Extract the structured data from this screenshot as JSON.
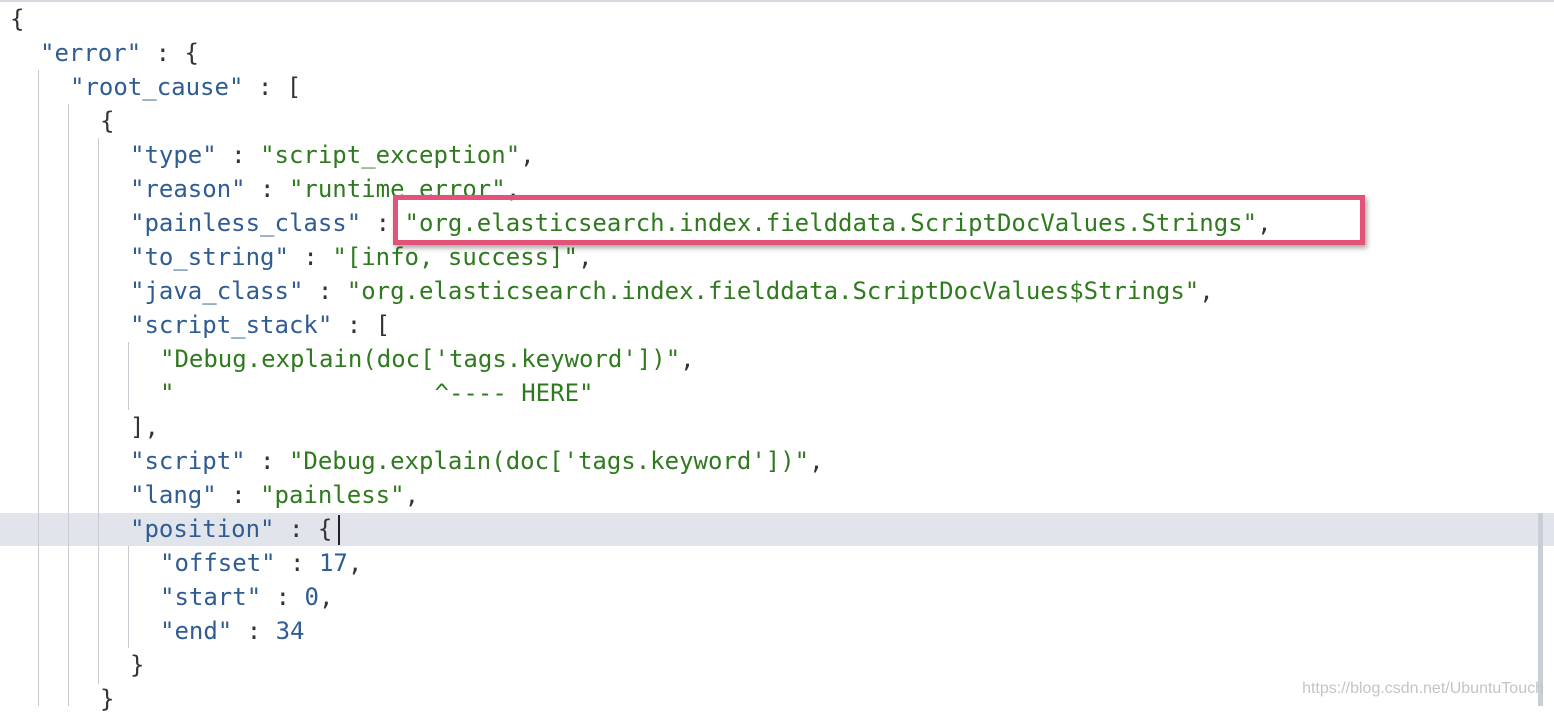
{
  "code_lines": [
    {
      "indent": 0,
      "parts": [
        {
          "t": "{",
          "c": "punc"
        }
      ]
    },
    {
      "indent": 1,
      "parts": [
        {
          "t": "\"error\"",
          "c": "key"
        },
        {
          "t": " : {",
          "c": "punc"
        }
      ]
    },
    {
      "indent": 2,
      "parts": [
        {
          "t": "\"root_cause\"",
          "c": "key"
        },
        {
          "t": " : [",
          "c": "punc"
        }
      ]
    },
    {
      "indent": 3,
      "parts": [
        {
          "t": "{",
          "c": "punc"
        }
      ]
    },
    {
      "indent": 4,
      "parts": [
        {
          "t": "\"type\"",
          "c": "key"
        },
        {
          "t": " : ",
          "c": "punc"
        },
        {
          "t": "\"script_exception\"",
          "c": "str"
        },
        {
          "t": ",",
          "c": "punc"
        }
      ]
    },
    {
      "indent": 4,
      "parts": [
        {
          "t": "\"reason\"",
          "c": "key"
        },
        {
          "t": " : ",
          "c": "punc"
        },
        {
          "t": "\"runtime error\"",
          "c": "str"
        },
        {
          "t": ",",
          "c": "punc"
        }
      ]
    },
    {
      "indent": 4,
      "parts": [
        {
          "t": "\"painless_class\"",
          "c": "key"
        },
        {
          "t": " : ",
          "c": "punc"
        },
        {
          "t": "\"org.elasticsearch.index.fielddata.ScriptDocValues.Strings\"",
          "c": "str"
        },
        {
          "t": ",",
          "c": "punc"
        }
      ]
    },
    {
      "indent": 4,
      "parts": [
        {
          "t": "\"to_string\"",
          "c": "key"
        },
        {
          "t": " : ",
          "c": "punc"
        },
        {
          "t": "\"[info, success]\"",
          "c": "str"
        },
        {
          "t": ",",
          "c": "punc"
        }
      ]
    },
    {
      "indent": 4,
      "parts": [
        {
          "t": "\"java_class\"",
          "c": "key"
        },
        {
          "t": " : ",
          "c": "punc"
        },
        {
          "t": "\"org.elasticsearch.index.fielddata.ScriptDocValues$Strings\"",
          "c": "str"
        },
        {
          "t": ",",
          "c": "punc"
        }
      ]
    },
    {
      "indent": 4,
      "parts": [
        {
          "t": "\"script_stack\"",
          "c": "key"
        },
        {
          "t": " : [",
          "c": "punc"
        }
      ]
    },
    {
      "indent": 5,
      "parts": [
        {
          "t": "\"Debug.explain(doc['tags.keyword'])\"",
          "c": "str"
        },
        {
          "t": ",",
          "c": "punc"
        }
      ]
    },
    {
      "indent": 5,
      "parts": [
        {
          "t": "\"                  ^---- HERE\"",
          "c": "str"
        }
      ]
    },
    {
      "indent": 4,
      "parts": [
        {
          "t": "],",
          "c": "punc"
        }
      ]
    },
    {
      "indent": 4,
      "parts": [
        {
          "t": "\"script\"",
          "c": "key"
        },
        {
          "t": " : ",
          "c": "punc"
        },
        {
          "t": "\"Debug.explain(doc['tags.keyword'])\"",
          "c": "str"
        },
        {
          "t": ",",
          "c": "punc"
        }
      ]
    },
    {
      "indent": 4,
      "parts": [
        {
          "t": "\"lang\"",
          "c": "key"
        },
        {
          "t": " : ",
          "c": "punc"
        },
        {
          "t": "\"painless\"",
          "c": "str"
        },
        {
          "t": ",",
          "c": "punc"
        }
      ]
    },
    {
      "indent": 4,
      "parts": [
        {
          "t": "\"position\"",
          "c": "key"
        },
        {
          "t": " : {",
          "c": "punc"
        }
      ]
    },
    {
      "indent": 5,
      "parts": [
        {
          "t": "\"offset\"",
          "c": "key"
        },
        {
          "t": " : ",
          "c": "punc"
        },
        {
          "t": "17",
          "c": "num"
        },
        {
          "t": ",",
          "c": "punc"
        }
      ]
    },
    {
      "indent": 5,
      "parts": [
        {
          "t": "\"start\"",
          "c": "key"
        },
        {
          "t": " : ",
          "c": "punc"
        },
        {
          "t": "0",
          "c": "num"
        },
        {
          "t": ",",
          "c": "punc"
        }
      ]
    },
    {
      "indent": 5,
      "parts": [
        {
          "t": "\"end\"",
          "c": "key"
        },
        {
          "t": " : ",
          "c": "punc"
        },
        {
          "t": "34",
          "c": "num"
        }
      ]
    },
    {
      "indent": 4,
      "parts": [
        {
          "t": "}",
          "c": "punc"
        }
      ]
    },
    {
      "indent": 3,
      "parts": [
        {
          "t": "}",
          "c": "punc"
        }
      ]
    }
  ],
  "watermark": "https://blog.csdn.net/UbuntuTouch",
  "colors": {
    "key": "#2f5c93",
    "string": "#2f7a1f",
    "number": "#2f5c93",
    "highlight_border": "#e4527a",
    "active_line_bg": "#e1e5eb"
  }
}
